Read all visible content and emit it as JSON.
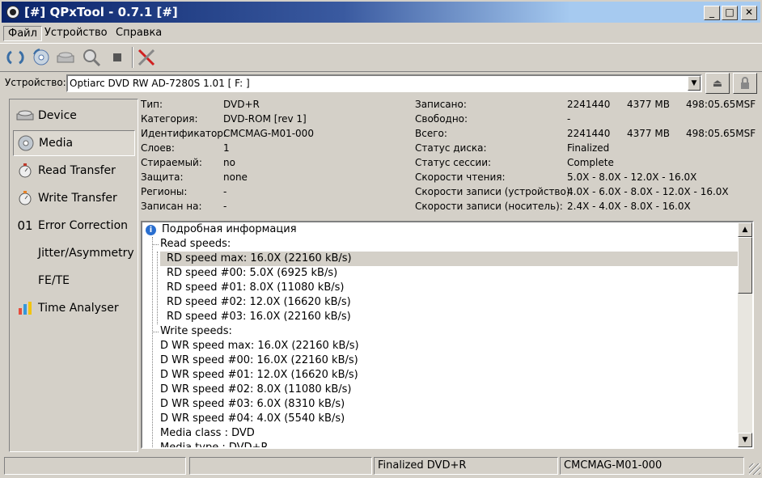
{
  "window": {
    "title": "[#] QPxTool - 0.7.1 [#]",
    "min": "_",
    "max": "□",
    "close": "✕"
  },
  "menu": [
    "Файл",
    "Устройство",
    "Справка"
  ],
  "device": {
    "label": "Устройство:",
    "value": "Optiarc  DVD RW AD-7280S  1.01 [ F: ]"
  },
  "sidebar": [
    {
      "label": "Device",
      "icon": "drive-icon",
      "active": false
    },
    {
      "label": "Media",
      "icon": "disc-icon",
      "active": true
    },
    {
      "label": "Read Transfer",
      "icon": "stopwatch-icon",
      "active": false
    },
    {
      "label": "Write Transfer",
      "icon": "stopwatch-icon",
      "active": false
    },
    {
      "label": "Error Correction",
      "icon": "binary-icon",
      "active": false
    },
    {
      "label": "Jitter/Asymmetry",
      "icon": "none",
      "active": false
    },
    {
      "label": "FE/TE",
      "icon": "none",
      "active": false
    },
    {
      "label": "Time Analyser",
      "icon": "bar-chart-icon",
      "active": false
    }
  ],
  "sidebar_icon_text": {
    "binary": "01"
  },
  "info_left": [
    {
      "k": "Тип:",
      "v": "DVD+R"
    },
    {
      "k": "Категория:",
      "v": "DVD-ROM [rev 1]"
    },
    {
      "k": "Идентификатор:",
      "v": "CMCMAG-M01-000"
    },
    {
      "k": "Слоев:",
      "v": "1"
    },
    {
      "k": "Стираемый:",
      "v": "no"
    },
    {
      "k": "Защита:",
      "v": "none"
    },
    {
      "k": "Регионы:",
      "v": "-"
    },
    {
      "k": "Записан на:",
      "v": "-"
    }
  ],
  "info_right": [
    {
      "k": "Записано:",
      "v1": "2241440",
      "v2": "4377 MB",
      "v3": "498:05.65MSF"
    },
    {
      "k": "Свободно:",
      "v1": "-",
      "v2": "",
      "v3": ""
    },
    {
      "k": "Всего:",
      "v1": "2241440",
      "v2": "4377 MB",
      "v3": "498:05.65MSF"
    },
    {
      "k": "Статус диска:",
      "v1": "Finalized",
      "v2": "",
      "v3": ""
    },
    {
      "k": "Статус сессии:",
      "v1": "Complete",
      "v2": "",
      "v3": ""
    },
    {
      "k": "Скорости чтения:",
      "v1": "5.0X - 8.0X - 12.0X - 16.0X",
      "v2": "",
      "v3": ""
    },
    {
      "k": "Скорости записи (устройство):",
      "v1": "4.0X - 6.0X - 8.0X - 12.0X - 16.0X",
      "v2": "",
      "v3": ""
    },
    {
      "k": "Скорости записи (носитель):",
      "v1": "2.4X - 4.0X - 8.0X - 16.0X",
      "v2": "",
      "v3": ""
    }
  ],
  "tree": {
    "root": "Подробная информация",
    "rows": [
      {
        "text": "Read speeds:",
        "level": 1,
        "sel": false
      },
      {
        "text": "RD speed max: 16.0X (22160 kB/s)",
        "level": 2,
        "sel": true
      },
      {
        "text": "RD speed #00:  5.0X (6925 kB/s)",
        "level": 2,
        "sel": false
      },
      {
        "text": "RD speed #01:  8.0X (11080 kB/s)",
        "level": 2,
        "sel": false
      },
      {
        "text": "RD speed #02: 12.0X (16620 kB/s)",
        "level": 2,
        "sel": false
      },
      {
        "text": "RD speed #03: 16.0X (22160 kB/s)",
        "level": 2,
        "sel": false
      },
      {
        "text": "Write speeds:",
        "level": 1,
        "sel": false
      },
      {
        "text": "D WR speed max: 16.0X (22160 kB/s)",
        "level": 1,
        "sel": false
      },
      {
        "text": "D WR speed #00: 16.0X (22160 kB/s)",
        "level": 1,
        "sel": false
      },
      {
        "text": "D WR speed #01: 12.0X (16620 kB/s)",
        "level": 1,
        "sel": false
      },
      {
        "text": "D WR speed #02:  8.0X (11080 kB/s)",
        "level": 1,
        "sel": false
      },
      {
        "text": "D WR speed #03:  6.0X (8310 kB/s)",
        "level": 1,
        "sel": false
      },
      {
        "text": "D WR speed #04:  4.0X (5540 kB/s)",
        "level": 1,
        "sel": false
      },
      {
        "text": "Media class   : DVD",
        "level": 1,
        "sel": false
      },
      {
        "text": "Media type    : DVD+R",
        "level": 1,
        "sel": false
      }
    ]
  },
  "status": [
    "",
    "",
    "Finalized DVD+R",
    "CMCMAG-M01-000"
  ]
}
